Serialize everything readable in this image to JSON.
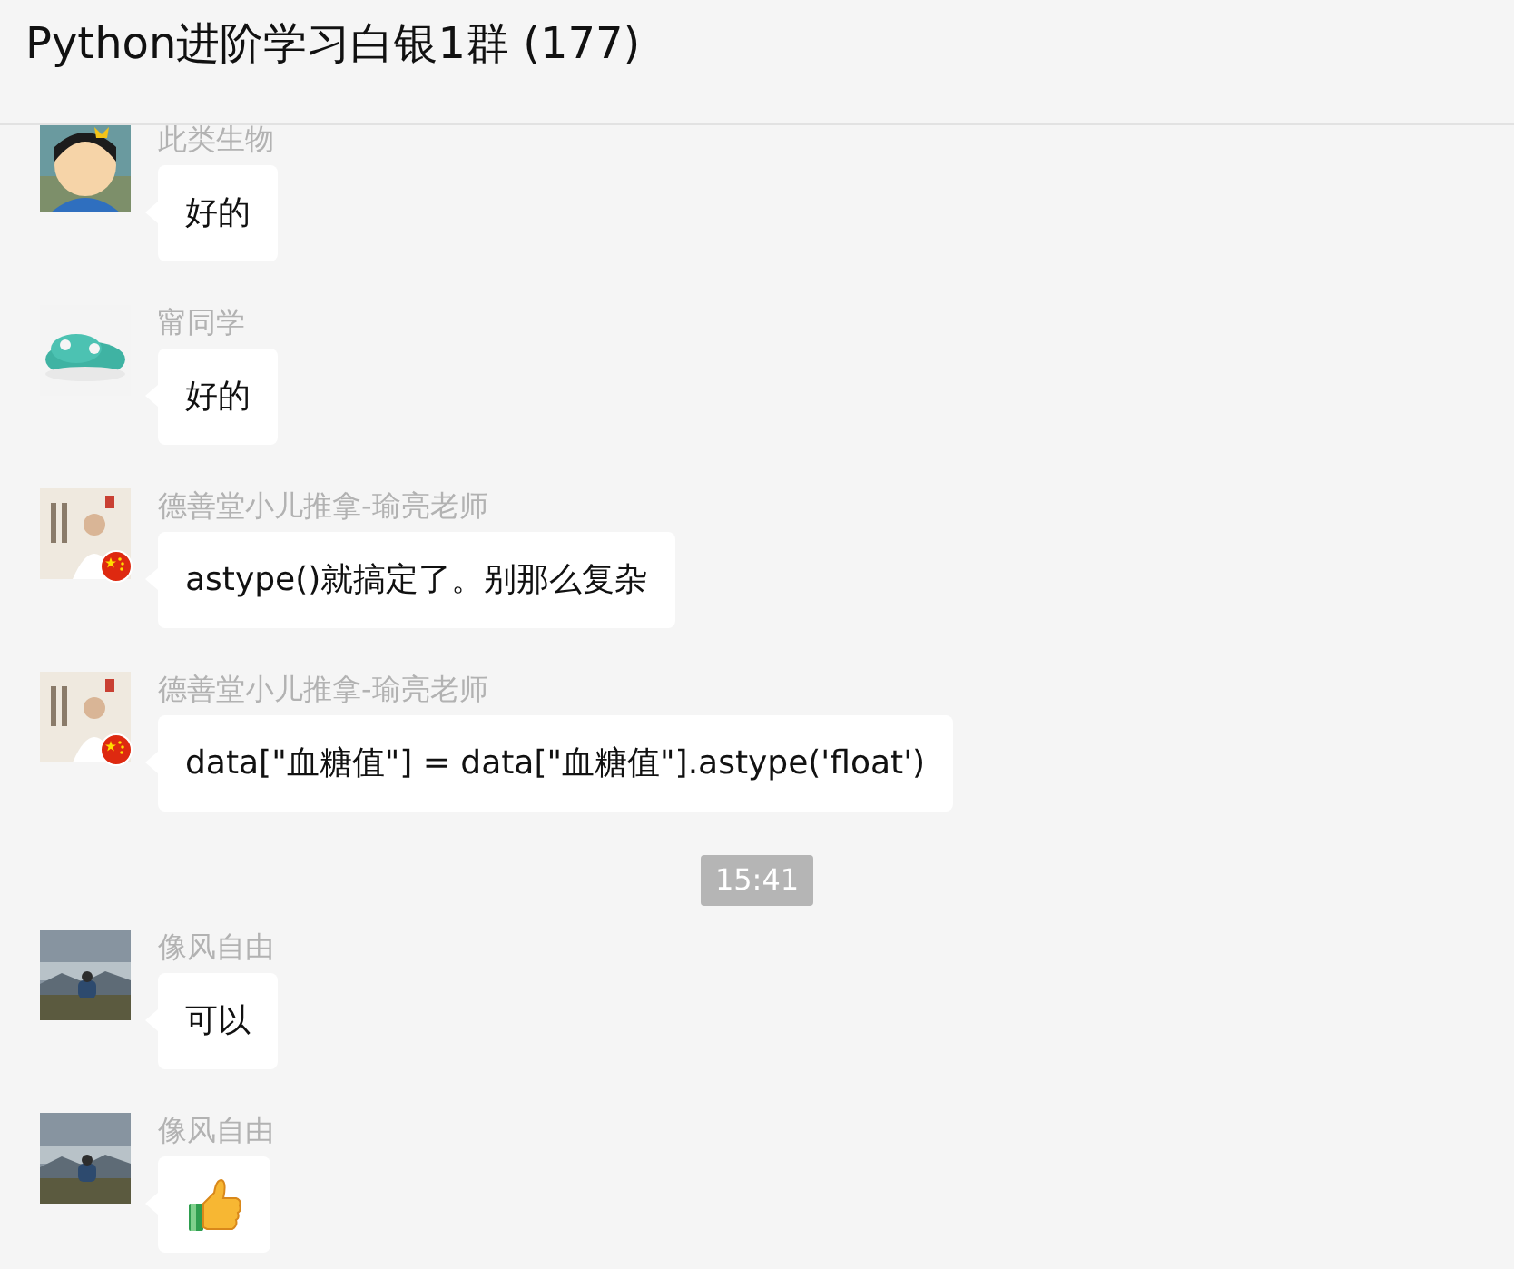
{
  "window": {
    "title": "Python进阶学习白银1群 (177)"
  },
  "messages": [
    {
      "kind": "text",
      "sender": "此类生物",
      "badge": false,
      "text": "好的"
    },
    {
      "kind": "text",
      "sender": "甯同学",
      "badge": false,
      "text": "好的"
    },
    {
      "kind": "text",
      "sender": "德善堂小儿推拿-瑜亮老师",
      "badge": true,
      "text": "astype()就搞定了。别那么复杂"
    },
    {
      "kind": "text",
      "sender": "德善堂小儿推拿-瑜亮老师",
      "badge": true,
      "text": "data[\"血糖值\"] = data[\"血糖值\"].astype('float')"
    },
    {
      "kind": "time",
      "text": "15:41"
    },
    {
      "kind": "text",
      "sender": "像风自由",
      "badge": false,
      "text": "可以"
    },
    {
      "kind": "sticker",
      "sender": "像风自由",
      "badge": false
    }
  ]
}
